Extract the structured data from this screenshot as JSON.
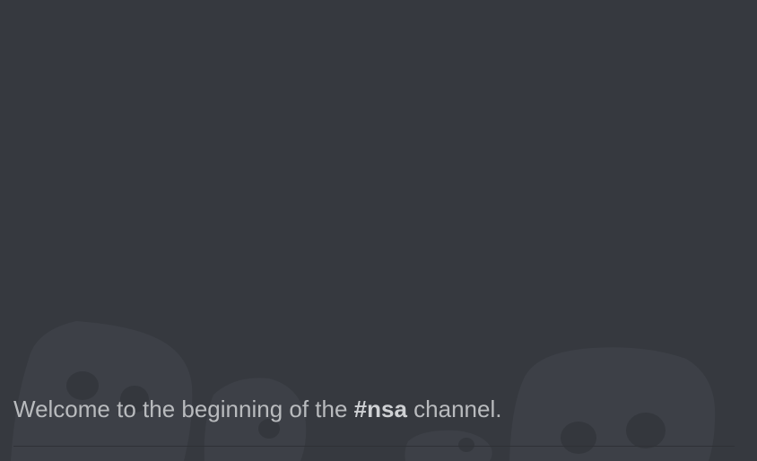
{
  "welcome": {
    "prefix": "Welcome to the beginning of the ",
    "channel_name": "#nsa",
    "suffix": " channel."
  },
  "background_art": {
    "icon": "discord-blob-icon"
  },
  "colors": {
    "background": "#36393f",
    "blob": "#3d4047",
    "blob_hole": "#34373d",
    "text": "#b9bbbe",
    "divider": "#2f3136"
  }
}
